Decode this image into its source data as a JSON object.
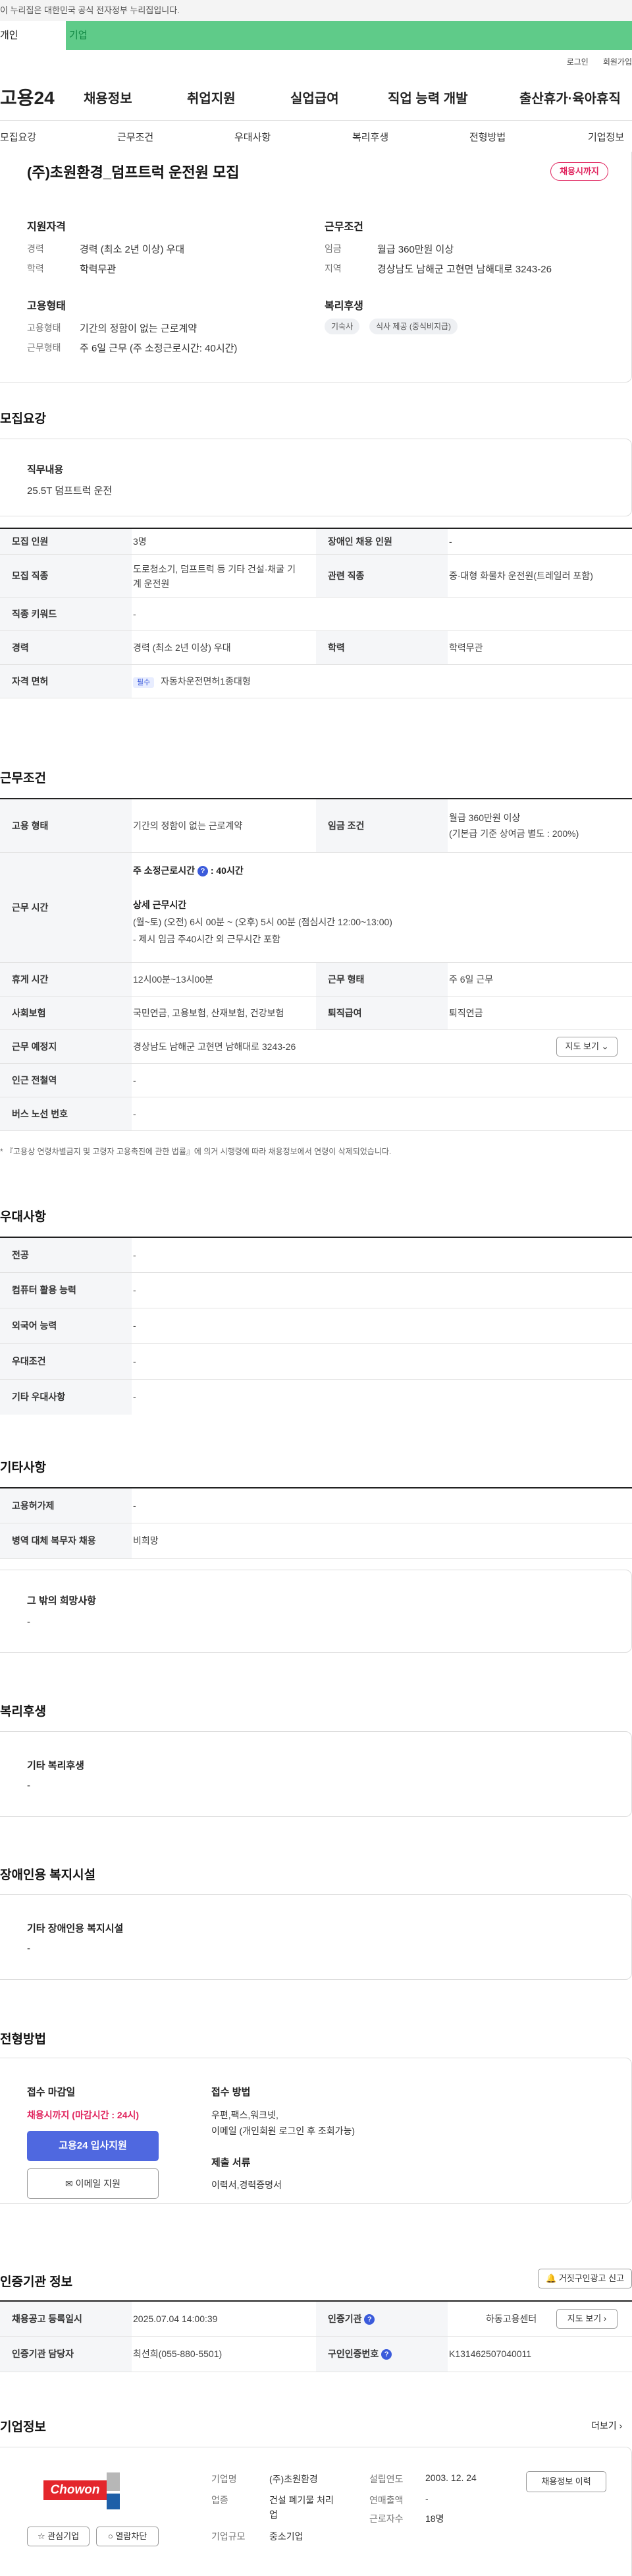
{
  "top": {
    "gov_text": "이 누리집은 대한민국 공식 전자정부 누리집입니다.",
    "tab_personal": "개인",
    "tab_corp": "기업",
    "login": "로그인",
    "join": "회원가입"
  },
  "gnb": {
    "logo": "고용24",
    "menu": [
      "채용정보",
      "취업지원",
      "실업급여",
      "직업 능력 개발",
      "출산휴가·육아휴직"
    ]
  },
  "subnav": [
    "모집요강",
    "근무조건",
    "우대사항",
    "복리후생",
    "전형방법",
    "기업정보"
  ],
  "summary": {
    "title": "(주)초원환경_덤프트럭 운전원 모집",
    "badge": "채용시까지",
    "qual_title": "지원자격",
    "career_l": "경력",
    "career_v": "경력 (최소 2년 이상) 우대",
    "edu_l": "학력",
    "edu_v": "학력무관",
    "emp_title": "고용형태",
    "emp_l": "고용형태",
    "emp_v": "기간의 정함이 없는 근로계약",
    "work_l": "근무형태",
    "work_v": "주 6일 근무 (주 소정근로시간: 40시간)",
    "cond_title": "근무조건",
    "wage_l": "임금",
    "wage_v": "월급 360만원 이상",
    "region_l": "지역",
    "region_v": "경상남도 남해군 고현면 남해대로 3243-26",
    "welfare_title": "복리후생",
    "chips": [
      "기숙사",
      "식사 제공 (중식비지급)"
    ]
  },
  "recruit": {
    "title": "모집요강",
    "duty_l": "직무내용",
    "duty_v": "25.5T 덤프트럭 운전",
    "rows": {
      "num_l": "모집 인원",
      "num_v": "3명",
      "dis_l": "장애인 채용 인원",
      "dis_v": "-",
      "job_l": "모집 직종",
      "job_v1": "도로청소기, 덤프트럭 등 기타 건설·채굴 기",
      "job_v2": "계 운전원",
      "rel_l": "관련 직종",
      "rel_v": "중·대형 화물차 운전원(트레일러 포함)",
      "kw_l": "직종 키워드",
      "kw_v": "-",
      "car_l": "경력",
      "car_v": "경력 (최소 2년 이상) 우대",
      "edu_l": "학력",
      "edu_v": "학력무관",
      "lic_l": "자격 면허",
      "lic_tag": "필수",
      "lic_v": "자동차운전면허1종대형"
    }
  },
  "work": {
    "title": "근무조건",
    "type_l": "고용 형태",
    "type_v": "기간의 정함이 없는 근로계약",
    "wage_l": "임금 조건",
    "wage_v1": "월급 360만원 이상",
    "wage_v2": "(기본급 기준 상여금 별도 : 200%)",
    "hours_l": "근무 시간",
    "hours_main": "주 소정근로시간",
    "hours_q": "?",
    "hours_main2": ": 40시간",
    "hours_detail": "상세 근무시간",
    "hours_d1": "(월~토) (오전) 6시 00분 ~ (오후) 5시 00분 (점심시간 12:00~13:00)",
    "hours_d2": "- 제시 임금 주40시간 외 근무시간 포함",
    "rest_l": "휴게 시간",
    "rest_v": "12시00분~13시00분",
    "form_l": "근무 형태",
    "form_v": "주 6일 근무",
    "ins_l": "사회보험",
    "ins_v": "국민연금, 고용보험, 산재보험, 건강보험",
    "ret_l": "퇴직급여",
    "ret_v": "퇴직연금",
    "loc_l": "근무 예정지",
    "loc_v": "경상남도 남해군 고현면 남해대로 3243-26",
    "map_btn": "지도 보기",
    "sub_l": "인근 전철역",
    "sub_v": "-",
    "bus_l": "버스 노선 번호",
    "bus_v": "-",
    "note": "* 『고용상 연령차별금지 및 고령자 고용촉진에 관한 법률』에 의거 시행령에 따라 채용정보에서 연령이 삭제되었습니다."
  },
  "pref": {
    "title": "우대사항",
    "major_l": "전공",
    "major_v": "-",
    "pc_l": "컴퓨터 활용 능력",
    "pc_v": "-",
    "lang_l": "외국어 능력",
    "lang_v": "-",
    "cond_l": "우대조건",
    "cond_v": "-",
    "etc_l": "기타 우대사항",
    "etc_v": "-"
  },
  "misc": {
    "title": "기타사항",
    "ins_l": "고용허가제",
    "ins_v": "-",
    "mil_l": "병역 대체 복무자 채용",
    "mil_v": "비희망",
    "other_l": "그 밖의 희망사항",
    "other_v": "-"
  },
  "welfare": {
    "title": "복리후생",
    "l": "기타 복리후생",
    "v": "-"
  },
  "disab": {
    "title": "장애인용 복지시설",
    "l": "기타 장애인용 복지시설",
    "v": "-"
  },
  "apply": {
    "title": "전형방법",
    "deadline_l": "접수 마감일",
    "deadline_v": "채용시까지 (마감시간 : 24시)",
    "apply_btn": "고용24 입사지원",
    "email_btn": "이메일 지원",
    "method_l": "접수 방법",
    "method_v1": "우편,팩스,워크넷,",
    "method_v2": "이메일 (개인회원 로그인 후 조회가능)",
    "docs_l": "제출 서류",
    "docs_v": "이력서,경력증명서"
  },
  "cert": {
    "title": "인증기관 정보",
    "report_btn": "거짓구인광고 신고",
    "reg_l": "채용공고 등록일시",
    "reg_v": "2025.07.04 14:00:39",
    "org_l": "인증기관",
    "org_v": "하동고용센터",
    "map_btn": "지도 보기",
    "mgr_l": "인증기관 담당자",
    "mgr_v": "최선희(055-880-5501)",
    "no_l": "구인인증번호",
    "no_v": "K131462507040011"
  },
  "company": {
    "title": "기업정보",
    "more": "더보기",
    "logo": "Chowon",
    "fav_btn": "관심기업",
    "block_btn": "열람차단",
    "name_l": "기업명",
    "name_v": "(주)초원환경",
    "ind_l": "업종",
    "ind_v1": "건설 폐기물 처리",
    "ind_v2": "업",
    "size_l": "기업규모",
    "size_v": "중소기업",
    "est_l": "설립연도",
    "est_v": "2003. 12. 24",
    "sales_l": "연매출액",
    "sales_v": "-",
    "emp_l": "근로자수",
    "emp_v": "18명",
    "hist_btn": "채용정보 이력"
  },
  "colors": {
    "brand_green": "#5fcb89",
    "accent_blue": "#4f68e0",
    "badge_red": "#e0245e"
  }
}
